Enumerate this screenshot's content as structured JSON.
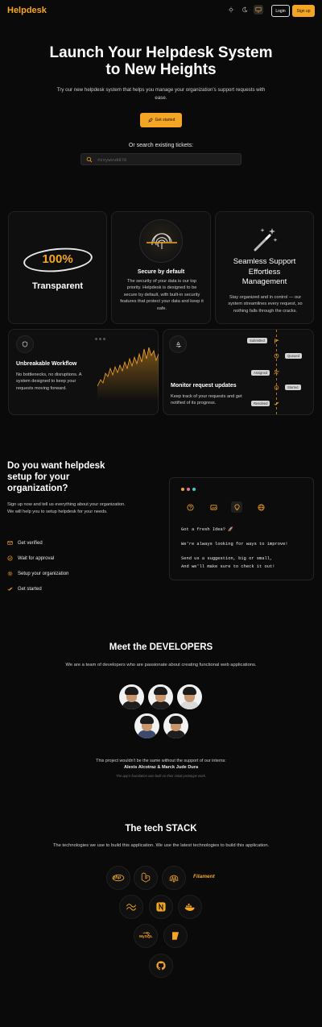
{
  "header": {
    "brand": "Helpdesk",
    "theme_options": [
      "sun-icon",
      "moon-icon",
      "monitor-icon"
    ],
    "login_label": "Login",
    "signup_label": "Sign up"
  },
  "hero": {
    "title_line1": "Launch Your Helpdesk System",
    "title_line2": "to New Heights",
    "subtitle": "Try our new helpdesk system that helps you manage your organization's support requests with ease.",
    "cta_label": "Get started",
    "search_label": "Or search existing tickets:",
    "search_placeholder": "#zxywvu9876"
  },
  "features": {
    "transparent": {
      "badge": "100%",
      "title": "Transparent"
    },
    "secure": {
      "title": "Secure by default",
      "text": "The security of your data is our top priority. Helpdesk is designed to be secure by default, with built-in security features that protect your data and keep it safe."
    },
    "seamless": {
      "title_line1": "Seamless Support",
      "title_line2": "Effortless",
      "title_line3": "Management",
      "text": "Stay organized and in control — our system streamlines every request, so nothing falls through the cracks."
    },
    "workflow": {
      "title": "Unbreakable Workflow",
      "text": "No bottlenecks, no disruptions. A system designed to keep your requests moving forward."
    },
    "monitor": {
      "title": "Monitor request updates",
      "text": "Keep track of your requests and get notified of its progress.",
      "statuses": [
        "Submitted",
        "Queued",
        "Assigned",
        "Started",
        "Resolved"
      ]
    }
  },
  "setup": {
    "title": "Do you want helpdesk setup for your organization?",
    "text": "Sign up now and tell us everything about your organization. We will help you to setup helpdesk for your needs.",
    "steps": [
      "Get verified",
      "Wait for approval",
      "Setup your organization",
      "Get started"
    ],
    "terminal_lines": [
      "Got a fresh Idea? 🚀",
      "We're always looking for ways to improve!",
      "Send us a suggestion, big or small,",
      "And we'll make sure to check it out!"
    ]
  },
  "developers": {
    "title": "Meet the DEVELOPERS",
    "subtitle": "We are a team of developers who are passionate about creating functional web applications.",
    "thanks": "This project wouldn't be the same without the support of our interns:",
    "interns": "Alexis Alcotraz & Marck Jude Dura",
    "note": "The app's foundation was built on their initial prototype work."
  },
  "tech": {
    "title": "The tech STACK",
    "subtitle": "The technologies we use to build this application. We use the latest technologies to build this application.",
    "labels": {
      "php": "php",
      "filament": "Filament",
      "mysql": "MySQL"
    }
  },
  "colors": {
    "accent": "#f5a524",
    "background": "#0a0a0a",
    "card": "#0f0f0f"
  }
}
